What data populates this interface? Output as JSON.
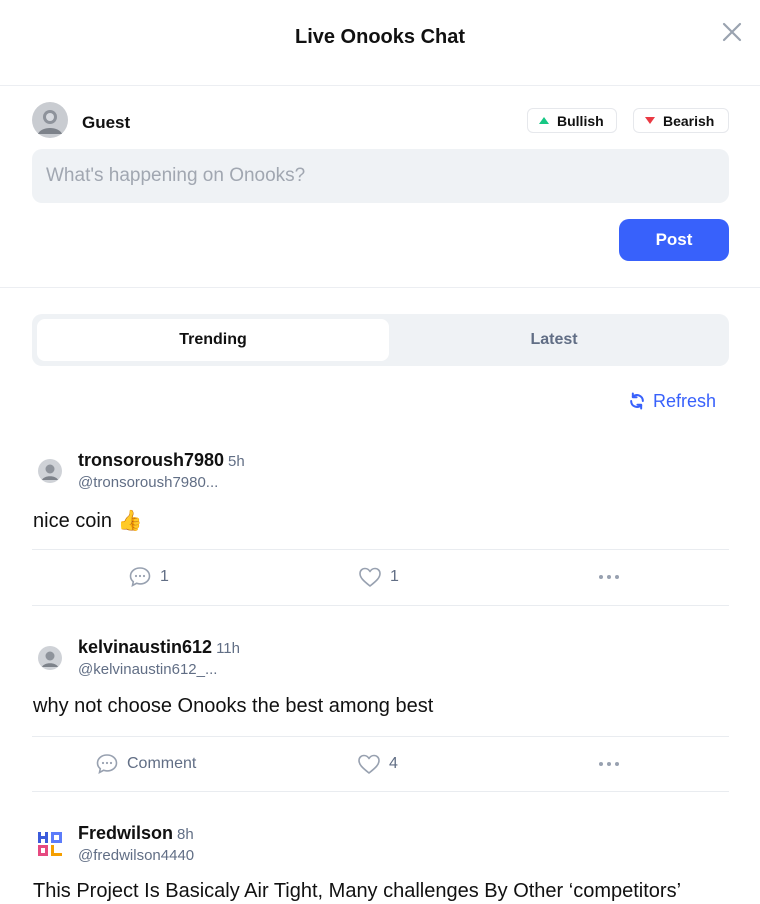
{
  "header": {
    "title": "Live Onooks Chat"
  },
  "composer": {
    "user_name": "Guest",
    "bullish_label": "Bullish",
    "bearish_label": "Bearish",
    "placeholder": "What's happening on Onooks?",
    "post_label": "Post"
  },
  "colors": {
    "accent": "#3861fb",
    "bullish": "#16c784",
    "bearish": "#ea3943",
    "muted": "#616e85"
  },
  "tabs": [
    {
      "label": "Trending",
      "active": true
    },
    {
      "label": "Latest",
      "active": false
    }
  ],
  "refresh_label": "Refresh",
  "posts": [
    {
      "username": "tronsoroush7980",
      "time": "5h",
      "handle": "@tronsoroush7980...",
      "text": "nice coin 👍",
      "comment_label": "1",
      "like_count": "1"
    },
    {
      "username": "kelvinaustin612",
      "time": "11h",
      "handle": "@kelvinaustin612_...",
      "text": "why not choose Onooks the best among best",
      "comment_label": "Comment",
      "like_count": "4"
    },
    {
      "username": "Fredwilson",
      "time": "8h",
      "handle": "@fredwilson4440",
      "avatar_text": "HODL",
      "text": "This Project Is Basicaly Air Tight, Many challenges By Other ‘competitors’"
    }
  ]
}
